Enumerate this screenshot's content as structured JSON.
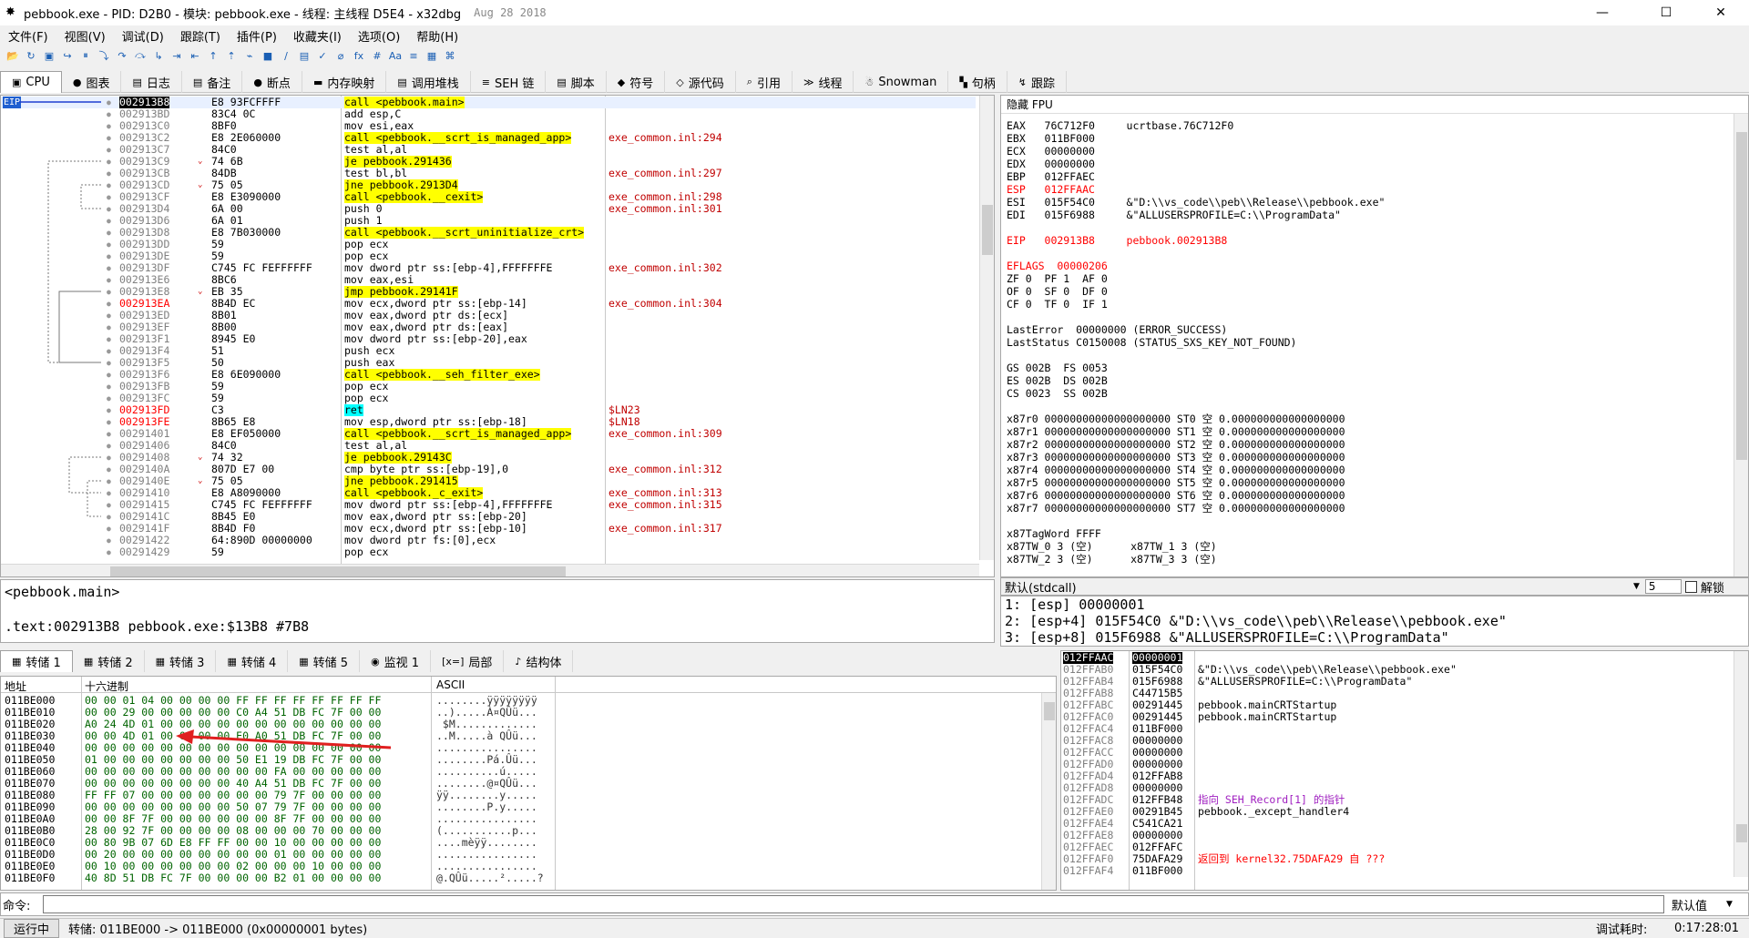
{
  "titlebar": {
    "title": "pebbook.exe - PID: D2B0 - 模块: pebbook.exe - 线程: 主线程 D5E4 - x32dbg",
    "date": "Aug 28 2018",
    "minimize": "—",
    "maximize": "☐",
    "close": "✕"
  },
  "menu": [
    "文件(F)",
    "视图(V)",
    "调试(D)",
    "跟踪(T)",
    "插件(P)",
    "收藏夹(I)",
    "选项(O)",
    "帮助(H)"
  ],
  "toolbar_icons": [
    "📂",
    "↻",
    "▣",
    "↪",
    "⏸",
    "⤵",
    "↷",
    "⤼",
    "↳",
    "⇥",
    "⇤",
    "↑",
    "⇡",
    "⌁",
    "■",
    "∕",
    "▤",
    "✓",
    "⌀",
    "fx",
    "#",
    "Aa",
    "≡",
    "▦",
    "⌘"
  ],
  "tabs": [
    {
      "label": "CPU",
      "icon": "▣"
    },
    {
      "label": "图表",
      "icon": "●"
    },
    {
      "label": "日志",
      "icon": "▤"
    },
    {
      "label": "备注",
      "icon": "▤"
    },
    {
      "label": "断点",
      "icon": "●"
    },
    {
      "label": "内存映射",
      "icon": "▬"
    },
    {
      "label": "调用堆栈",
      "icon": "▤"
    },
    {
      "label": "SEH 链",
      "icon": "≡"
    },
    {
      "label": "脚本",
      "icon": "▤"
    },
    {
      "label": "符号",
      "icon": "◆"
    },
    {
      "label": "源代码",
      "icon": "◇"
    },
    {
      "label": "引用",
      "icon": "⌕"
    },
    {
      "label": "线程",
      "icon": "≫"
    },
    {
      "label": "Snowman",
      "icon": "☃"
    },
    {
      "label": "句柄",
      "icon": "▚"
    },
    {
      "label": "跟踪",
      "icon": "↯"
    }
  ],
  "disasm": {
    "eip_label": "EIP",
    "rows": [
      {
        "addr": "002913B8",
        "bytes": "E8 93FCFFFF",
        "instr": "call <pebbook.main>",
        "comment": "",
        "hl": "call",
        "eip": true
      },
      {
        "addr": "002913BD",
        "bytes": "83C4 0C",
        "instr": "add esp,C",
        "comment": ""
      },
      {
        "addr": "002913C0",
        "bytes": "8BF0",
        "instr": "mov esi,eax",
        "comment": ""
      },
      {
        "addr": "002913C2",
        "bytes": "E8 2E060000",
        "instr": "call <pebbook.__scrt_is_managed_app>",
        "comment": "exe_common.inl:294",
        "hl": "call"
      },
      {
        "addr": "002913C7",
        "bytes": "84C0",
        "instr": "test al,al",
        "comment": ""
      },
      {
        "addr": "002913C9",
        "bytes": "74 6B",
        "instr": "je pebbook.291436",
        "comment": "",
        "hl": "jmp",
        "arrow": "v"
      },
      {
        "addr": "002913CB",
        "bytes": "84DB",
        "instr": "test bl,bl",
        "comment": "exe_common.inl:297"
      },
      {
        "addr": "002913CD",
        "bytes": "75 05",
        "instr": "jne pebbook.2913D4",
        "comment": "",
        "hl": "jmp",
        "arrow": "v"
      },
      {
        "addr": "002913CF",
        "bytes": "E8 E3090000",
        "instr": "call <pebbook.__cexit>",
        "comment": "exe_common.inl:298",
        "hl": "call"
      },
      {
        "addr": "002913D4",
        "bytes": "6A 00",
        "instr": "push 0",
        "comment": "exe_common.inl:301"
      },
      {
        "addr": "002913D6",
        "bytes": "6A 01",
        "instr": "push 1",
        "comment": ""
      },
      {
        "addr": "002913D8",
        "bytes": "E8 7B030000",
        "instr": "call <pebbook.__scrt_uninitialize_crt>",
        "comment": "",
        "hl": "call"
      },
      {
        "addr": "002913DD",
        "bytes": "59",
        "instr": "pop ecx",
        "comment": ""
      },
      {
        "addr": "002913DE",
        "bytes": "59",
        "instr": "pop ecx",
        "comment": ""
      },
      {
        "addr": "002913DF",
        "bytes": "C745 FC FEFFFFFF",
        "instr": "mov dword ptr ss:[ebp-4],FFFFFFFE",
        "comment": "exe_common.inl:302"
      },
      {
        "addr": "002913E6",
        "bytes": "8BC6",
        "instr": "mov eax,esi",
        "comment": ""
      },
      {
        "addr": "002913E8",
        "bytes": "EB 35",
        "instr": "jmp pebbook.29141F",
        "comment": "",
        "hl": "jmp",
        "arrow": "v"
      },
      {
        "addr": "002913EA",
        "bytes": "8B4D EC",
        "instr": "mov ecx,dword ptr ss:[ebp-14]",
        "comment": "exe_common.inl:304",
        "red": true
      },
      {
        "addr": "002913ED",
        "bytes": "8B01",
        "instr": "mov eax,dword ptr ds:[ecx]",
        "comment": ""
      },
      {
        "addr": "002913EF",
        "bytes": "8B00",
        "instr": "mov eax,dword ptr ds:[eax]",
        "comment": ""
      },
      {
        "addr": "002913F1",
        "bytes": "8945 E0",
        "instr": "mov dword ptr ss:[ebp-20],eax",
        "comment": ""
      },
      {
        "addr": "002913F4",
        "bytes": "51",
        "instr": "push ecx",
        "comment": ""
      },
      {
        "addr": "002913F5",
        "bytes": "50",
        "instr": "push eax",
        "comment": ""
      },
      {
        "addr": "002913F6",
        "bytes": "E8 6E090000",
        "instr": "call <pebbook.__seh_filter_exe>",
        "comment": "",
        "hl": "call"
      },
      {
        "addr": "002913FB",
        "bytes": "59",
        "instr": "pop ecx",
        "comment": ""
      },
      {
        "addr": "002913FC",
        "bytes": "59",
        "instr": "pop ecx",
        "comment": ""
      },
      {
        "addr": "002913FD",
        "bytes": "C3",
        "instr": "ret",
        "comment": "$LN23",
        "hl": "ret",
        "red": true
      },
      {
        "addr": "002913FE",
        "bytes": "8B65 E8",
        "instr": "mov esp,dword ptr ss:[ebp-18]",
        "comment": "$LN18",
        "red": true
      },
      {
        "addr": "00291401",
        "bytes": "E8 EF050000",
        "instr": "call <pebbook.__scrt_is_managed_app>",
        "comment": "exe_common.inl:309",
        "hl": "call"
      },
      {
        "addr": "00291406",
        "bytes": "84C0",
        "instr": "test al,al",
        "comment": ""
      },
      {
        "addr": "00291408",
        "bytes": "74 32",
        "instr": "je pebbook.29143C",
        "comment": "",
        "hl": "jmp",
        "arrow": "v"
      },
      {
        "addr": "0029140A",
        "bytes": "807D E7 00",
        "instr": "cmp byte ptr ss:[ebp-19],0",
        "comment": "exe_common.inl:312"
      },
      {
        "addr": "0029140E",
        "bytes": "75 05",
        "instr": "jne pebbook.291415",
        "comment": "",
        "hl": "jmp",
        "arrow": "v"
      },
      {
        "addr": "00291410",
        "bytes": "E8 A8090000",
        "instr": "call <pebbook._c_exit>",
        "comment": "exe_common.inl:313",
        "hl": "call"
      },
      {
        "addr": "00291415",
        "bytes": "C745 FC FEFFFFFF",
        "instr": "mov dword ptr ss:[ebp-4],FFFFFFFE",
        "comment": "exe_common.inl:315"
      },
      {
        "addr": "0029141C",
        "bytes": "8B45 E0",
        "instr": "mov eax,dword ptr ss:[ebp-20]",
        "comment": ""
      },
      {
        "addr": "0029141F",
        "bytes": "8B4D F0",
        "instr": "mov ecx,dword ptr ss:[ebp-10]",
        "comment": "exe_common.inl:317"
      },
      {
        "addr": "00291422",
        "bytes": "64:890D 00000000",
        "instr": "mov dword ptr fs:[0],ecx",
        "comment": ""
      },
      {
        "addr": "00291429",
        "bytes": "59",
        "instr": "pop ecx",
        "comment": ""
      }
    ]
  },
  "registers": {
    "header": "隐藏 FPU",
    "lines": [
      {
        "t": "EAX   76C712F0     ucrtbase.76C712F0"
      },
      {
        "t": "EBX   011BF000"
      },
      {
        "t": "ECX   00000000"
      },
      {
        "t": "EDX   00000000"
      },
      {
        "t": "EBP   012FFAEC"
      },
      {
        "t": "ESP   012FFAAC",
        "red": true
      },
      {
        "t": "ESI   015F54C0     &\"D:\\\\vs_code\\\\peb\\\\Release\\\\pebbook.exe\""
      },
      {
        "t": "EDI   015F6988     &\"ALLUSERSPROFILE=C:\\\\ProgramData\""
      },
      {
        "t": ""
      },
      {
        "t": "EIP   002913B8     pebbook.002913B8",
        "red": true
      },
      {
        "t": ""
      },
      {
        "t": "EFLAGS  00000206",
        "red": true
      },
      {
        "t": "ZF 0  PF 1  AF 0"
      },
      {
        "t": "OF 0  SF 0  DF 0"
      },
      {
        "t": "CF 0  TF 0  IF 1"
      },
      {
        "t": ""
      },
      {
        "t": "LastError  00000000 (ERROR_SUCCESS)"
      },
      {
        "t": "LastStatus C0150008 (STATUS_SXS_KEY_NOT_FOUND)"
      },
      {
        "t": ""
      },
      {
        "t": "GS 002B  FS 0053"
      },
      {
        "t": "ES 002B  DS 002B"
      },
      {
        "t": "CS 0023  SS 002B"
      },
      {
        "t": ""
      },
      {
        "t": "x87r0 00000000000000000000 ST0 空 0.000000000000000000"
      },
      {
        "t": "x87r1 00000000000000000000 ST1 空 0.000000000000000000"
      },
      {
        "t": "x87r2 00000000000000000000 ST2 空 0.000000000000000000"
      },
      {
        "t": "x87r3 00000000000000000000 ST3 空 0.000000000000000000"
      },
      {
        "t": "x87r4 00000000000000000000 ST4 空 0.000000000000000000"
      },
      {
        "t": "x87r5 00000000000000000000 ST5 空 0.000000000000000000"
      },
      {
        "t": "x87r6 00000000000000000000 ST6 空 0.000000000000000000"
      },
      {
        "t": "x87r7 00000000000000000000 ST7 空 0.000000000000000000"
      },
      {
        "t": ""
      },
      {
        "t": "x87TagWord FFFF"
      },
      {
        "t": "x87TW_0 3 (空)      x87TW_1 3 (空)"
      },
      {
        "t": "x87TW_2 3 (空)      x87TW_3 3 (空)"
      }
    ]
  },
  "callconv": {
    "label": "默认(stdcall)",
    "count": "5",
    "unlock": "解锁"
  },
  "args": [
    "1: [esp] 00000001",
    "2: [esp+4] 015F54C0 &\"D:\\\\vs_code\\\\peb\\\\Release\\\\pebbook.exe\"",
    "3: [esp+8] 015F6988 &\"ALLUSERSPROFILE=C:\\\\ProgramData\""
  ],
  "info": {
    "line1": "<pebbook.main>",
    "line2": ".text:002913B8 pebbook.exe:$13B8 #7B8"
  },
  "dump_tabs": [
    {
      "label": "转储 1",
      "icon": "▦"
    },
    {
      "label": "转储 2",
      "icon": "▦"
    },
    {
      "label": "转储 3",
      "icon": "▦"
    },
    {
      "label": "转储 4",
      "icon": "▦"
    },
    {
      "label": "转储 5",
      "icon": "▦"
    },
    {
      "label": "监视 1",
      "icon": "◉"
    },
    {
      "label": "局部",
      "icon": "[x=]"
    },
    {
      "label": "结构体",
      "icon": "♪"
    }
  ],
  "dump": {
    "headers": {
      "addr": "地址",
      "hex": "十六进制",
      "ascii": "ASCII"
    },
    "rows": [
      {
        "addr": "011BE000",
        "hex": "00 00 01 04 00 00 00 00 FF FF FF FF FF FF FF FF",
        "ascii": "........ÿÿÿÿÿÿÿÿ"
      },
      {
        "addr": "011BE010",
        "hex": "00 00 29 00 00 00 00 00 C0 A4 51 DB FC 7F 00 00",
        "ascii": "..).....À¤QÛü..."
      },
      {
        "addr": "011BE020",
        "hex": "A0 24 4D 01 00 00 00 00 00 00 00 00 00 00 00 00",
        "ascii": " $M............."
      },
      {
        "addr": "011BE030",
        "hex": "00 00 4D 01 00 00 00 00 E0 A0 51 DB FC 7F 00 00",
        "ascii": "..M.....à QÛü..."
      },
      {
        "addr": "011BE040",
        "hex": "00 00 00 00 00 00 00 00 00 00 00 00 00 00 00 00",
        "ascii": "................"
      },
      {
        "addr": "011BE050",
        "hex": "01 00 00 00 00 00 00 00 50 E1 19 DB FC 7F 00 00",
        "ascii": "........Pá.Ûü..."
      },
      {
        "addr": "011BE060",
        "hex": "00 00 00 00 00 00 00 00 00 00 FA 00 00 00 00 00",
        "ascii": "..........ú....."
      },
      {
        "addr": "011BE070",
        "hex": "00 00 00 00 00 00 00 00 40 A4 51 DB FC 7F 00 00",
        "ascii": "........@¤QÛü..."
      },
      {
        "addr": "011BE080",
        "hex": "FF FF 07 00 00 00 00 00 00 00 79 7F 00 00 00 00",
        "ascii": "ÿÿ........y....."
      },
      {
        "addr": "011BE090",
        "hex": "00 00 00 00 00 00 00 00 50 07 79 7F 00 00 00 00",
        "ascii": "........P.y....."
      },
      {
        "addr": "011BE0A0",
        "hex": "00 00 8F 7F 00 00 00 00 00 00 8F 7F 00 00 00 00",
        "ascii": "................"
      },
      {
        "addr": "011BE0B0",
        "hex": "28 00 92 7F 00 00 00 00 08 00 00 00 70 00 00 00",
        "ascii": "(...........p..."
      },
      {
        "addr": "011BE0C0",
        "hex": "00 80 9B 07 6D E8 FF FF 00 00 10 00 00 00 00 00",
        "ascii": "....mèÿÿ........"
      },
      {
        "addr": "011BE0D0",
        "hex": "00 20 00 00 00 00 00 00 00 00 01 00 00 00 00 00",
        "ascii": "................"
      },
      {
        "addr": "011BE0E0",
        "hex": "00 10 00 00 00 00 00 00 02 00 00 00 10 00 00 00",
        "ascii": "................"
      },
      {
        "addr": "011BE0F0",
        "hex": "40 8D 51 DB FC 7F 00 00 00 00 B2 01 00 00 00 00",
        "ascii": "@.QÛü.....².....?"
      }
    ]
  },
  "stack": {
    "rows": [
      {
        "addr": "012FFAAC",
        "val": "00000001",
        "cmt": "",
        "sel": true
      },
      {
        "addr": "012FFAB0",
        "val": "015F54C0",
        "cmt": "&\"D:\\\\vs_code\\\\peb\\\\Release\\\\pebbook.exe\""
      },
      {
        "addr": "012FFAB4",
        "val": "015F6988",
        "cmt": "&\"ALLUSERSPROFILE=C:\\\\ProgramData\""
      },
      {
        "addr": "012FFAB8",
        "val": "C44715B5",
        "cmt": ""
      },
      {
        "addr": "012FFABC",
        "val": "00291445",
        "cmt": "pebbook.mainCRTStartup"
      },
      {
        "addr": "012FFAC0",
        "val": "00291445",
        "cmt": "pebbook.mainCRTStartup"
      },
      {
        "addr": "012FFAC4",
        "val": "011BF000",
        "cmt": ""
      },
      {
        "addr": "012FFAC8",
        "val": "00000000",
        "cmt": ""
      },
      {
        "addr": "012FFACC",
        "val": "00000000",
        "cmt": ""
      },
      {
        "addr": "012FFAD0",
        "val": "00000000",
        "cmt": ""
      },
      {
        "addr": "012FFAD4",
        "val": "012FFAB8",
        "cmt": ""
      },
      {
        "addr": "012FFAD8",
        "val": "00000000",
        "cmt": ""
      },
      {
        "addr": "012FFADC",
        "val": "012FFB48",
        "cmt": "指向 SEH_Record[1] 的指针",
        "cc": "purple"
      },
      {
        "addr": "012FFAE0",
        "val": "00291B45",
        "cmt": "pebbook._except_handler4"
      },
      {
        "addr": "012FFAE4",
        "val": "C541CA21",
        "cmt": ""
      },
      {
        "addr": "012FFAE8",
        "val": "00000000",
        "cmt": ""
      },
      {
        "addr": "012FFAEC",
        "val": "012FFAFC",
        "cmt": ""
      },
      {
        "addr": "012FFAF0",
        "val": "75DAFA29",
        "cmt": "返回到 kernel32.75DAFA29 自 ???",
        "cc": "red"
      },
      {
        "addr": "012FFAF4",
        "val": "011BF000",
        "cmt": ""
      }
    ]
  },
  "command": {
    "label": "命令:",
    "default": "默认值"
  },
  "status": {
    "state": "运行中",
    "msg": "转储: 011BE000 -> 011BE000 (0x00000001 bytes)",
    "timer_label": "调试耗时:",
    "timer": "0:17:28:01"
  },
  "colors": {
    "call_bg": "#ffff00",
    "jmp_bg": "#ffff00",
    "ret_bg": "#00ffff",
    "addr_gray": "#808080",
    "red": "#ff0000",
    "comment": "#c00000",
    "sel": "#000000"
  }
}
